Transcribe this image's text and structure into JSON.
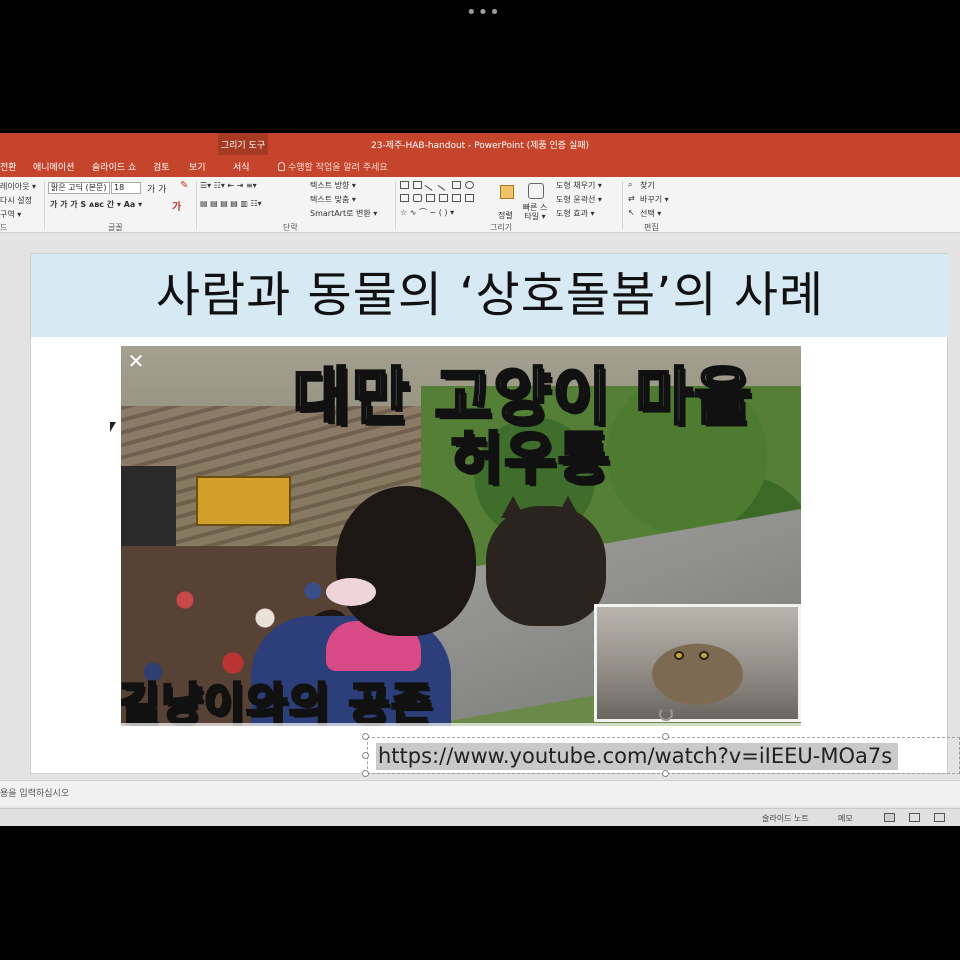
{
  "window": {
    "title": "23-제주-HAB-handout - PowerPoint (제품 인증 실패)",
    "context_group": "그리기 도구"
  },
  "tabs": [
    {
      "label": "전환"
    },
    {
      "label": "애니메이션"
    },
    {
      "label": "슬라이드 쇼"
    },
    {
      "label": "검토"
    },
    {
      "label": "보기"
    },
    {
      "label": "서식"
    }
  ],
  "tell_me": "수행할 작업을 알려 주세요",
  "ribbon": {
    "slides_group": {
      "layout": "레이아웃 ▾",
      "reset": "다시 설정",
      "section": "구역 ▾",
      "label": "드"
    },
    "font_group": {
      "font_name": "맑은 고딕 (본문)",
      "font_size": "18",
      "label": "글꼴"
    },
    "paragraph_group": {
      "text_direction": "텍스트 방향 ▾",
      "align_text": "텍스트 맞춤 ▾",
      "smartart": "SmartArt로 변환 ▾",
      "label": "단락"
    },
    "drawing_group": {
      "arrange": "정렬",
      "quick_styles": "빠른 스타일 ▾",
      "shape_fill": "도형 채우기 ▾",
      "shape_outline": "도형 윤곽선 ▾",
      "shape_effects": "도형 효과 ▾",
      "label": "그리기"
    },
    "editing_group": {
      "find": "찾기",
      "replace": "바꾸기 ▾",
      "select": "선택 ▾",
      "label": "편집"
    }
  },
  "slide": {
    "title": "사람과 동물의 ‘상호돌봄’의 사례",
    "video": {
      "caption_top_1": "대만 고양이 마을",
      "caption_top_2": "허우통",
      "caption_bottom": "길냥이와의 공존",
      "close_glyph": "✕"
    },
    "link_text": "https://www.youtube.com/watch?v=iIEEU-MOa7s"
  },
  "notes_placeholder": "용을 입력하십시오",
  "statusbar": {
    "slide_notes": "슬라이드 노트",
    "comments": "메모"
  }
}
